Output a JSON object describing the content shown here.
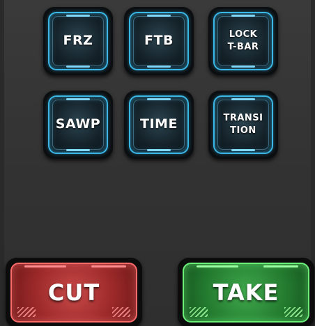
{
  "colors": {
    "background": "#333333",
    "key_accent": "#3ab7e6",
    "cut_red": "#b83838",
    "take_green": "#2f9a3c"
  },
  "keys": [
    {
      "label": "FRZ"
    },
    {
      "label": "FTB"
    },
    {
      "label": "LOCK\nT-BAR"
    },
    {
      "label": "SAWP"
    },
    {
      "label": "TIME"
    },
    {
      "label": "TRANSI\nTION"
    }
  ],
  "actions": {
    "cut_label": "CUT",
    "take_label": "TAKE"
  }
}
